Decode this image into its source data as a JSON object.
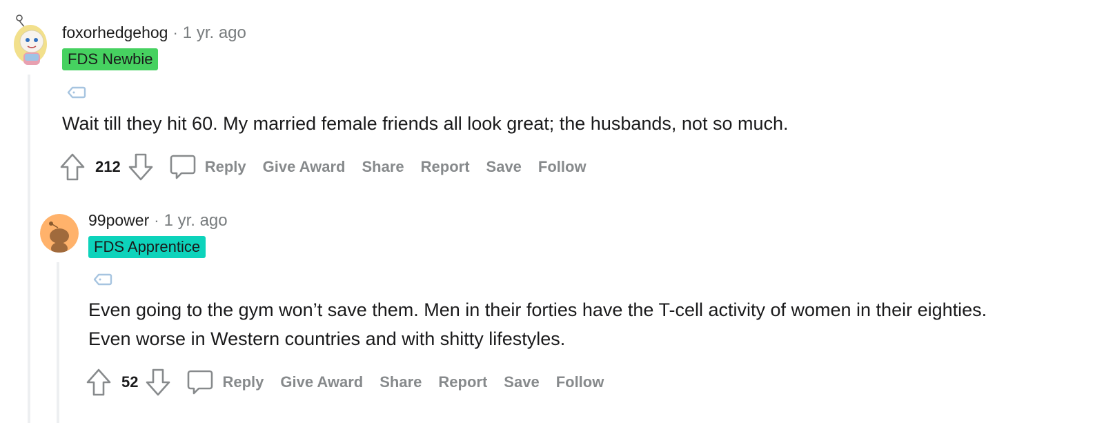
{
  "comments": [
    {
      "author": "foxorhedgehog",
      "separator": "·",
      "time": "1 yr. ago",
      "flair": "FDS Newbie",
      "flair_color": "#46d160",
      "body": [
        "Wait till they hit 60. My married female friends all look great; the husbands, not so much."
      ],
      "score": "212",
      "actions": {
        "reply": "Reply",
        "give_award": "Give Award",
        "share": "Share",
        "report": "Report",
        "save": "Save",
        "follow": "Follow"
      }
    },
    {
      "author": "99power",
      "separator": "·",
      "time": "1 yr. ago",
      "flair": "FDS Apprentice",
      "flair_color": "#0dd3bb",
      "body": [
        "Even going to the gym won’t save them. Men in their forties have the T-cell activity of women in their eighties.",
        "Even worse in Western countries and with shitty lifestyles."
      ],
      "score": "52",
      "actions": {
        "reply": "Reply",
        "give_award": "Give Award",
        "share": "Share",
        "report": "Report",
        "save": "Save",
        "follow": "Follow"
      }
    }
  ],
  "colors": {
    "meta_grey": "#787c7e",
    "action_grey": "#878a8c",
    "tag_blue": "#a6c4e0",
    "thread_line": "#edeff1",
    "avatar2_bg": "#ffb26b"
  },
  "icons": [
    "snoo-avatar-icon",
    "tag-icon",
    "upvote-arrow-icon",
    "downvote-arrow-icon",
    "comment-bubble-icon"
  ]
}
